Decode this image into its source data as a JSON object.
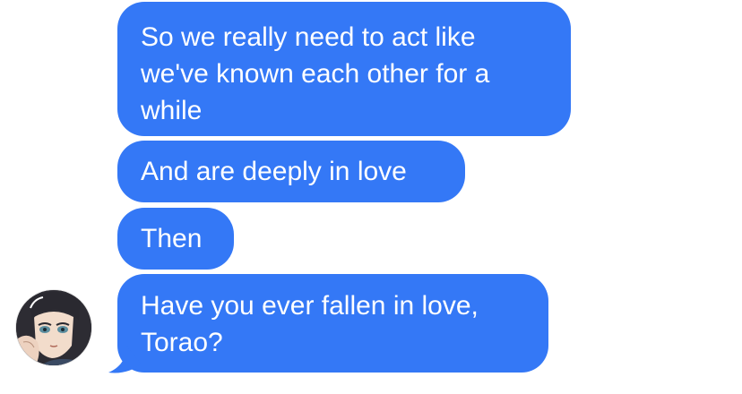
{
  "conversation": {
    "messages": [
      {
        "text": "So we really need to act like\nwe've known each other for a\nwhile"
      },
      {
        "text": "And are deeply in love"
      },
      {
        "text": "Then"
      },
      {
        "text": "Have you ever fallen in love,\nTorao?"
      }
    ],
    "sender": {
      "avatar_icon": "anime-character-avatar-icon"
    }
  },
  "colors": {
    "bubble": "#3478f6",
    "bubble_text": "#ffffff",
    "background": "#ffffff"
  }
}
